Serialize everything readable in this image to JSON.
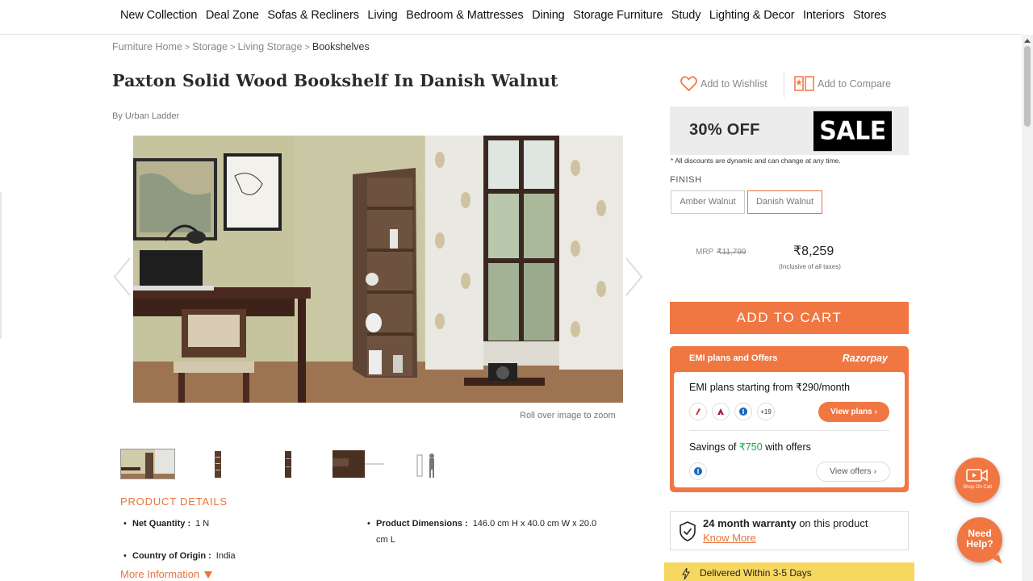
{
  "nav": {
    "items": [
      "New Collection",
      "Deal Zone",
      "Sofas & Recliners",
      "Living",
      "Bedroom & Mattresses",
      "Dining",
      "Storage Furniture",
      "Study",
      "Lighting & Decor",
      "Interiors",
      "Stores"
    ]
  },
  "breadcrumb": {
    "items": [
      "Furniture Home",
      "Storage",
      "Living Storage"
    ],
    "separator": ">",
    "current": "Bookshelves"
  },
  "product": {
    "title": "Paxton Solid Wood Bookshelf In Danish Walnut",
    "brand": "By Urban Ladder",
    "zoom_hint": "Roll over image to zoom"
  },
  "actions": {
    "wishlist": "Add to Wishlist",
    "compare": "Add to Compare"
  },
  "offer": {
    "discount": "30% OFF",
    "badge": "SALE",
    "disclaimer": "* All discounts are dynamic and can change at any time."
  },
  "finish": {
    "label": "FINISH",
    "options": [
      "Amber Walnut",
      "Danish Walnut"
    ],
    "selected": "Danish Walnut"
  },
  "pricing": {
    "mrp_label": "MRP",
    "mrp": "₹11,799",
    "price": "₹8,259",
    "tax_note": "(Inclusive of all taxes)"
  },
  "cart": {
    "label": "ADD TO CART"
  },
  "emi": {
    "header": "EMI plans and Offers",
    "provider": "Razorpay",
    "plans_prefix": "EMI plans starting from ",
    "plans_amount": "₹290/month",
    "more_banks": "+19",
    "view_plans": "View plans",
    "savings_prefix": "Savings of ",
    "savings_amount": "₹750",
    "savings_suffix": " with offers",
    "view_offers": "View offers"
  },
  "warranty": {
    "bold": "24 month warranty",
    "rest": " on this product",
    "link": "Know More"
  },
  "delivery": {
    "text": "Delivered Within 3-5 Days"
  },
  "details": {
    "heading": "PRODUCT DETAILS",
    "net_qty_label": "Net Quantity :",
    "net_qty_value": "1 N",
    "dimensions_label": "Product Dimensions :",
    "dimensions_value_line1": "146.0 cm H x 40.0 cm W x 20.0",
    "dimensions_value_line2": "cm L",
    "origin_label": "Country of Origin :",
    "origin_value": "India",
    "more_info": "More Information"
  },
  "floating": {
    "call_label": "Shop On Call",
    "help_label_1": "Need",
    "help_label_2": "Help?"
  },
  "colors": {
    "accent": "#f07742",
    "accent_text": "#e8743b",
    "savings_green": "#1ba84a",
    "delivery_yellow": "#f6d760"
  }
}
